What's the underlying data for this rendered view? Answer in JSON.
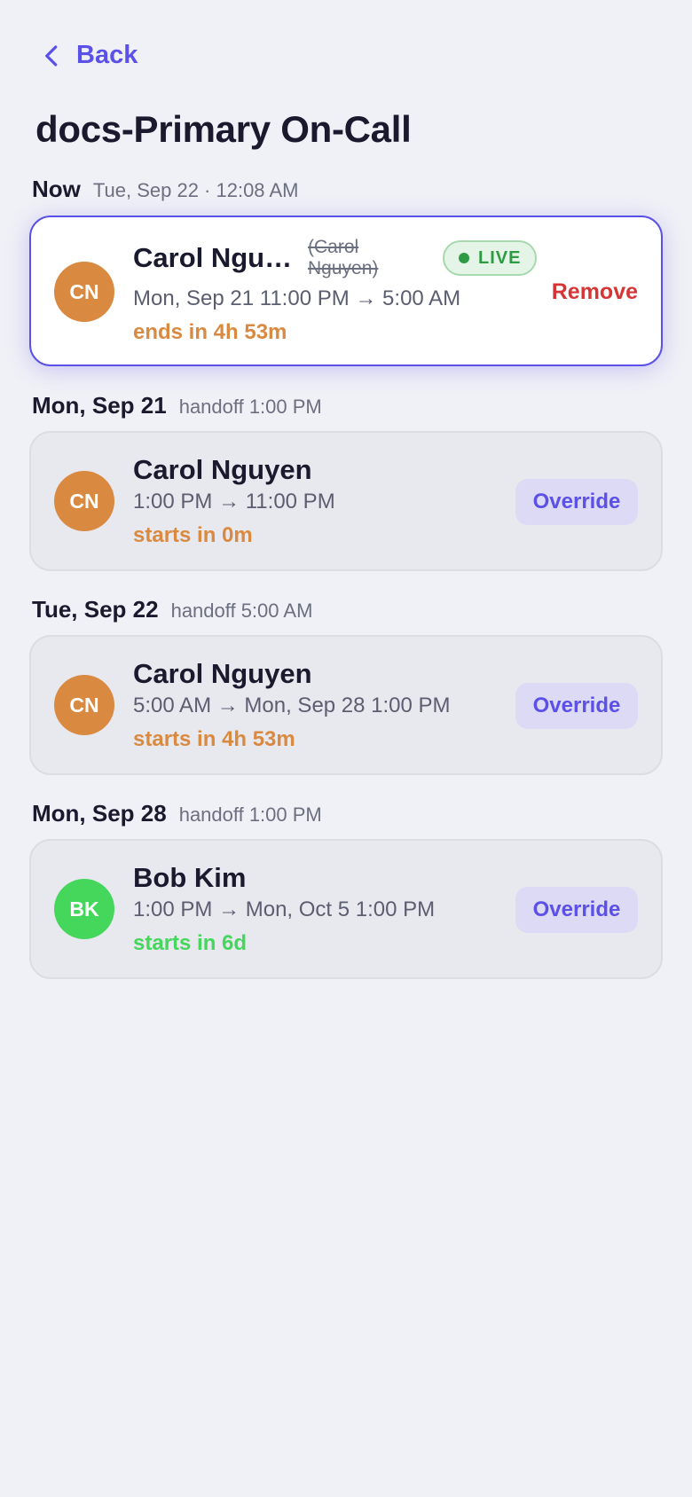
{
  "nav": {
    "back_label": "Back"
  },
  "page": {
    "title": "docs-Primary On-Call"
  },
  "colors": {
    "accent": "#5b50e8",
    "orange": "#d98a40",
    "green": "#45d65c",
    "danger": "#d63535",
    "live_green": "#2e9a44"
  },
  "now": {
    "label": "Now",
    "timestamp": "Tue, Sep 22 · 12:08 AM",
    "card": {
      "initials": "CN",
      "name": "Carol Ngu…",
      "original_name": "(Carol Nguyen)",
      "live_label": "LIVE",
      "time_start": "Mon, Sep 21 11:00 PM",
      "arrow": "→",
      "time_end": "5:00 AM",
      "relative": "ends in 4h 53m",
      "remove_label": "Remove"
    }
  },
  "schedule": [
    {
      "date": "Mon, Sep 21",
      "handoff": "handoff 1:00 PM",
      "initials": "CN",
      "name": "Carol Nguyen",
      "time_start": "1:00 PM",
      "arrow": "→",
      "time_end": "11:00 PM",
      "relative": "starts in 0m",
      "override_label": "Override"
    },
    {
      "date": "Tue, Sep 22",
      "handoff": "handoff 5:00 AM",
      "initials": "CN",
      "name": "Carol Nguyen",
      "time_start": "5:00 AM",
      "arrow": "→",
      "time_end": "Mon, Sep 28 1:00 PM",
      "relative": "starts in 4h 53m",
      "override_label": "Override"
    },
    {
      "date": "Mon, Sep 28",
      "handoff": "handoff 1:00 PM",
      "initials": "BK",
      "name": "Bob Kim",
      "time_start": "1:00 PM",
      "arrow": "→",
      "time_end": "Mon, Oct 5 1:00 PM",
      "relative": "starts in 6d",
      "override_label": "Override"
    }
  ]
}
